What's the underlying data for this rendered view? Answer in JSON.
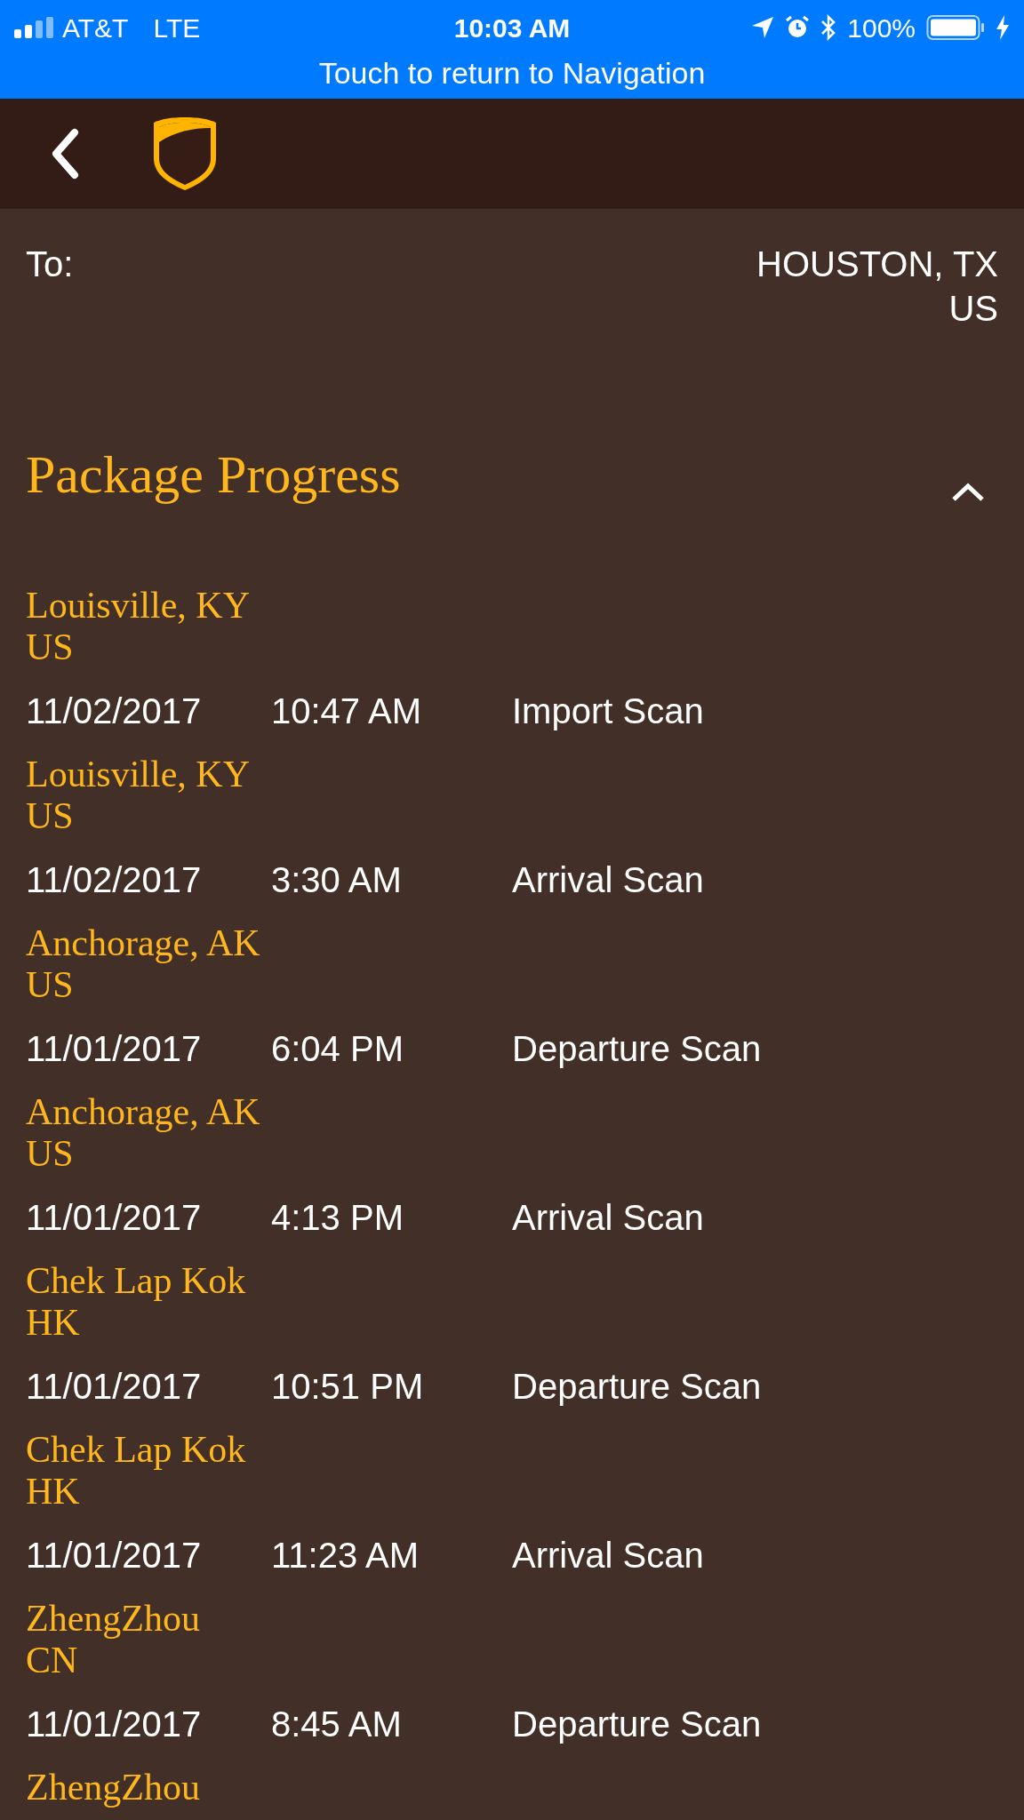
{
  "status_bar": {
    "carrier": "AT&T",
    "network": "LTE",
    "time": "10:03 AM",
    "battery": "100%"
  },
  "banner": {
    "text": "Touch to return to Navigation"
  },
  "destination": {
    "label": "To:",
    "lines": [
      "HOUSTON, TX",
      "US"
    ]
  },
  "progress": {
    "title": "Package Progress",
    "expanded": true,
    "events": [
      {
        "location": [
          "Louisville, KY",
          "US"
        ],
        "date": "11/02/2017",
        "time": "10:47 AM",
        "activity": "Import Scan"
      },
      {
        "location": [
          "Louisville, KY",
          "US"
        ],
        "date": "11/02/2017",
        "time": "3:30 AM",
        "activity": "Arrival Scan"
      },
      {
        "location": [
          "Anchorage, AK",
          "US"
        ],
        "date": "11/01/2017",
        "time": "6:04 PM",
        "activity": "Departure Scan"
      },
      {
        "location": [
          "Anchorage, AK",
          "US"
        ],
        "date": "11/01/2017",
        "time": "4:13 PM",
        "activity": "Arrival Scan"
      },
      {
        "location": [
          "Chek Lap Kok",
          "HK"
        ],
        "date": "11/01/2017",
        "time": "10:51 PM",
        "activity": "Departure Scan"
      },
      {
        "location": [
          "Chek Lap Kok",
          "HK"
        ],
        "date": "11/01/2017",
        "time": "11:23 AM",
        "activity": "Arrival Scan"
      },
      {
        "location": [
          "ZhengZhou",
          "CN"
        ],
        "date": "11/01/2017",
        "time": "8:45 AM",
        "activity": "Departure Scan"
      },
      {
        "location": [
          "ZhengZhou"
        ]
      }
    ]
  }
}
